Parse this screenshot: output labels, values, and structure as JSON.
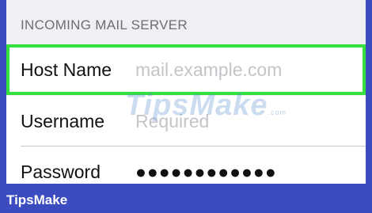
{
  "section": {
    "header": "INCOMING MAIL SERVER"
  },
  "fields": [
    {
      "label": "Host Name",
      "placeholder": "mail.example.com"
    },
    {
      "label": "Username",
      "placeholder": "Required"
    },
    {
      "label": "Password",
      "value": "●●●●●●●●●●●●"
    }
  ],
  "watermark": {
    "text": "TipsMake",
    "suffix": ".com"
  },
  "footer": {
    "brand": "TipsMake"
  },
  "colors": {
    "highlight": "#35e13f",
    "frame": "#3b4cc0"
  }
}
